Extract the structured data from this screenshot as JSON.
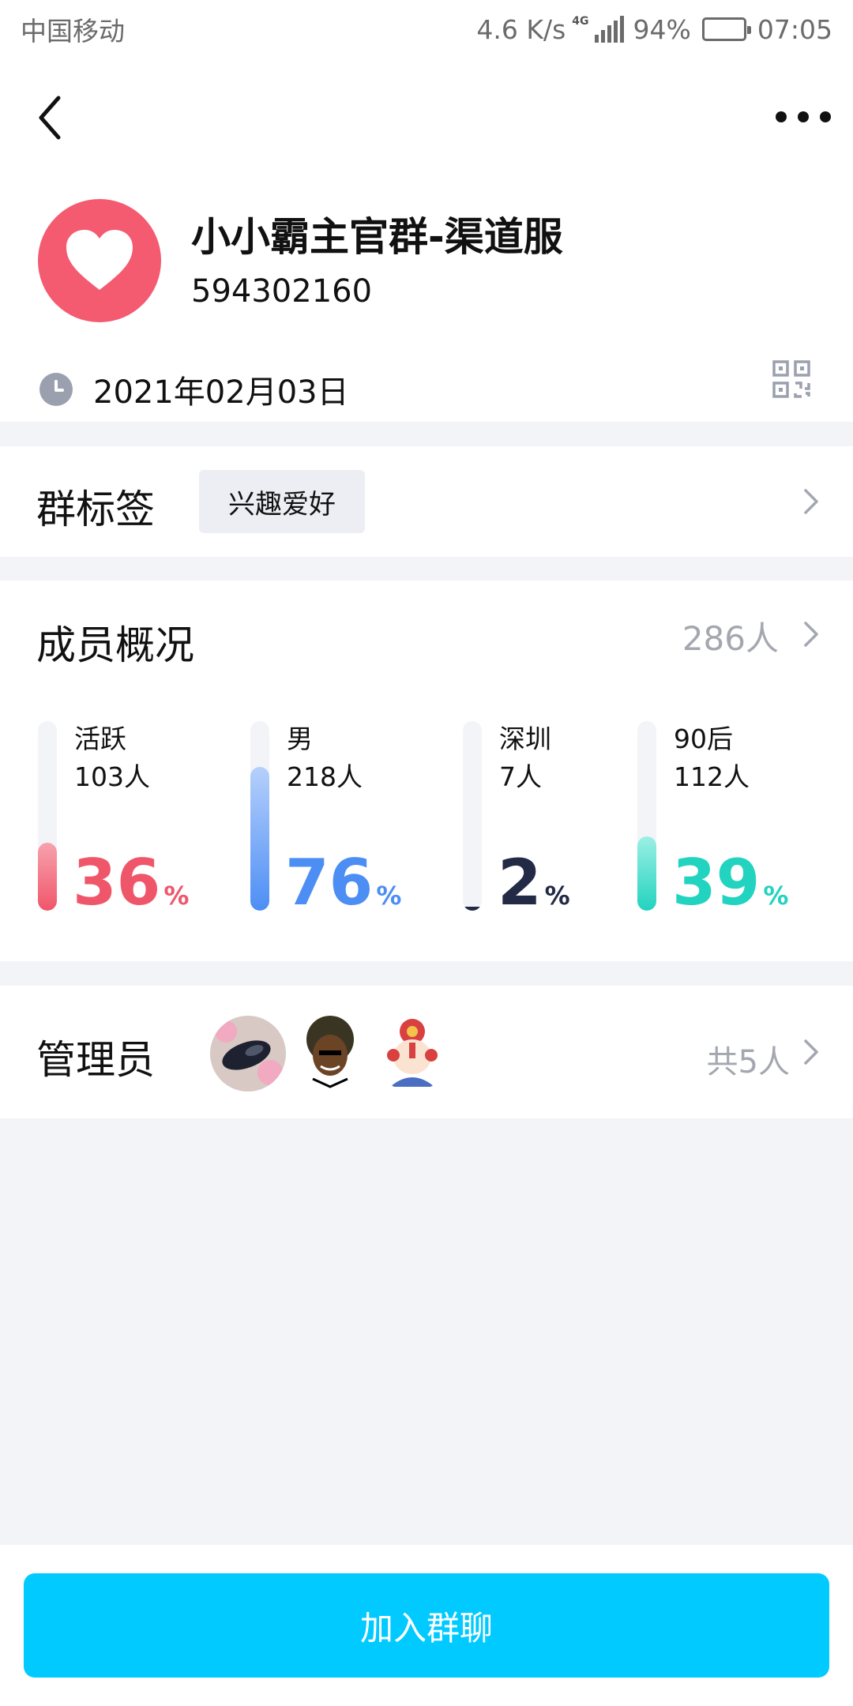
{
  "status_bar": {
    "carrier": "中国移动",
    "speed": "4.6 K/s",
    "network": "4G",
    "battery": "94%",
    "battery_level": 0.94,
    "time": "07:05"
  },
  "nav": {
    "back_icon": "chevron-left-icon",
    "more_icon": "more-dots-icon"
  },
  "group": {
    "name": "小小霸主官群-渠道服",
    "id": "594302160",
    "created_date": "2021年02月03日",
    "avatar_color": "#f45a70"
  },
  "tags": {
    "title": "群标签",
    "items": [
      "兴趣爱好"
    ]
  },
  "members": {
    "title": "成员概况",
    "total": "286人",
    "stats": [
      {
        "label": "活跃",
        "count": "103人",
        "percent": "36",
        "percent_symbol": "%",
        "fraction": 0.36,
        "color": "#f0566a",
        "fill_top": "#f7a2ad"
      },
      {
        "label": "男",
        "count": "218人",
        "percent": "76",
        "percent_symbol": "%",
        "fraction": 0.76,
        "color": "#4d8ef5",
        "fill_top": "#b6d0fb"
      },
      {
        "label": "深圳",
        "count": "7人",
        "percent": "2",
        "percent_symbol": "%",
        "fraction": 0.02,
        "color": "#232a45",
        "fill_top": "#232a45"
      },
      {
        "label": "90后",
        "count": "112人",
        "percent": "39",
        "percent_symbol": "%",
        "fraction": 0.39,
        "color": "#22d3bf",
        "fill_top": "#9cefe5"
      }
    ]
  },
  "admins": {
    "title": "管理员",
    "count": "共5人"
  },
  "actions": {
    "join_label": "加入群聊",
    "join_color": "#00caff"
  }
}
